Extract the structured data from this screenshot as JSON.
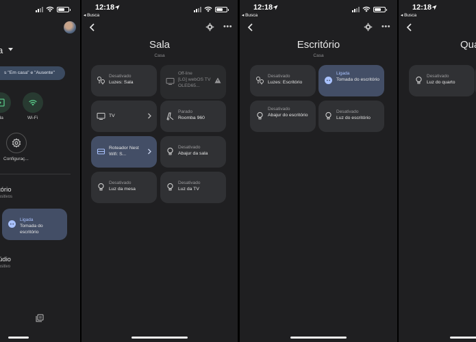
{
  "panel1": {
    "home_name": "a",
    "chip_label": "s \"Em casa\" e \"Ausente\"",
    "quick_actions": [
      {
        "label": "ada"
      },
      {
        "label": "Wi-Fi"
      }
    ],
    "settings_label": "Configuraç...",
    "sections": [
      {
        "title": "tório",
        "subtitle": "ositivos"
      },
      {
        "title": "údio",
        "subtitle": "ositivo"
      }
    ],
    "device": {
      "status": "Ligada",
      "name": "Tomada do escritório"
    }
  },
  "panel2": {
    "time": "12:18",
    "back_label": "◂ Busca",
    "room_title": "Sala",
    "room_subtitle": "Casa",
    "devices": [
      {
        "status": "Desativado",
        "name": "Luzes: Sala",
        "icon": "light-group-icon",
        "state": "normal"
      },
      {
        "status": "Off-line",
        "name": "[LG] webOS TV OLED65...",
        "icon": "tv-icon",
        "state": "offline"
      },
      {
        "status": "",
        "name": "TV",
        "icon": "tv-icon",
        "state": "normal"
      },
      {
        "status": "Parado",
        "name": "Roomba 960",
        "icon": "vacuum-icon",
        "state": "normal"
      },
      {
        "status": "",
        "name": "Roteador Nest Wifi: S...",
        "icon": "router-icon",
        "state": "on"
      },
      {
        "status": "Desativado",
        "name": "Abajur da sala",
        "icon": "bulb-icon",
        "state": "normal"
      },
      {
        "status": "Desativado",
        "name": "Luz da mesa",
        "icon": "bulb-icon",
        "state": "normal"
      },
      {
        "status": "Desativado",
        "name": "Luz da TV",
        "icon": "bulb-icon",
        "state": "normal"
      }
    ]
  },
  "panel3": {
    "time": "12:18",
    "back_label": "◂ Busca",
    "room_title": "Escritório",
    "room_subtitle": "Casa",
    "devices": [
      {
        "status": "Desativado",
        "name": "Luzes: Escritório",
        "icon": "light-group-icon",
        "state": "normal"
      },
      {
        "status": "Ligada",
        "name": "Tomada do escritório",
        "icon": "plug-icon",
        "state": "on"
      },
      {
        "status": "Desativado",
        "name": "Abajur do escritório",
        "icon": "bulb-icon",
        "state": "normal"
      },
      {
        "status": "Desativado",
        "name": "Luz do escritório",
        "icon": "bulb-icon",
        "state": "normal"
      }
    ]
  },
  "panel4": {
    "time": "12:18",
    "back_label": "◂ Busca",
    "room_title": "Qua",
    "devices": [
      {
        "status": "Desativado",
        "name": "Luz do quarto",
        "icon": "bulb-icon",
        "state": "normal"
      }
    ]
  },
  "colors": {
    "background": "#1f1f21",
    "card": "#303134",
    "card_on": "#434e66",
    "accent_on": "#a9c2ff"
  }
}
